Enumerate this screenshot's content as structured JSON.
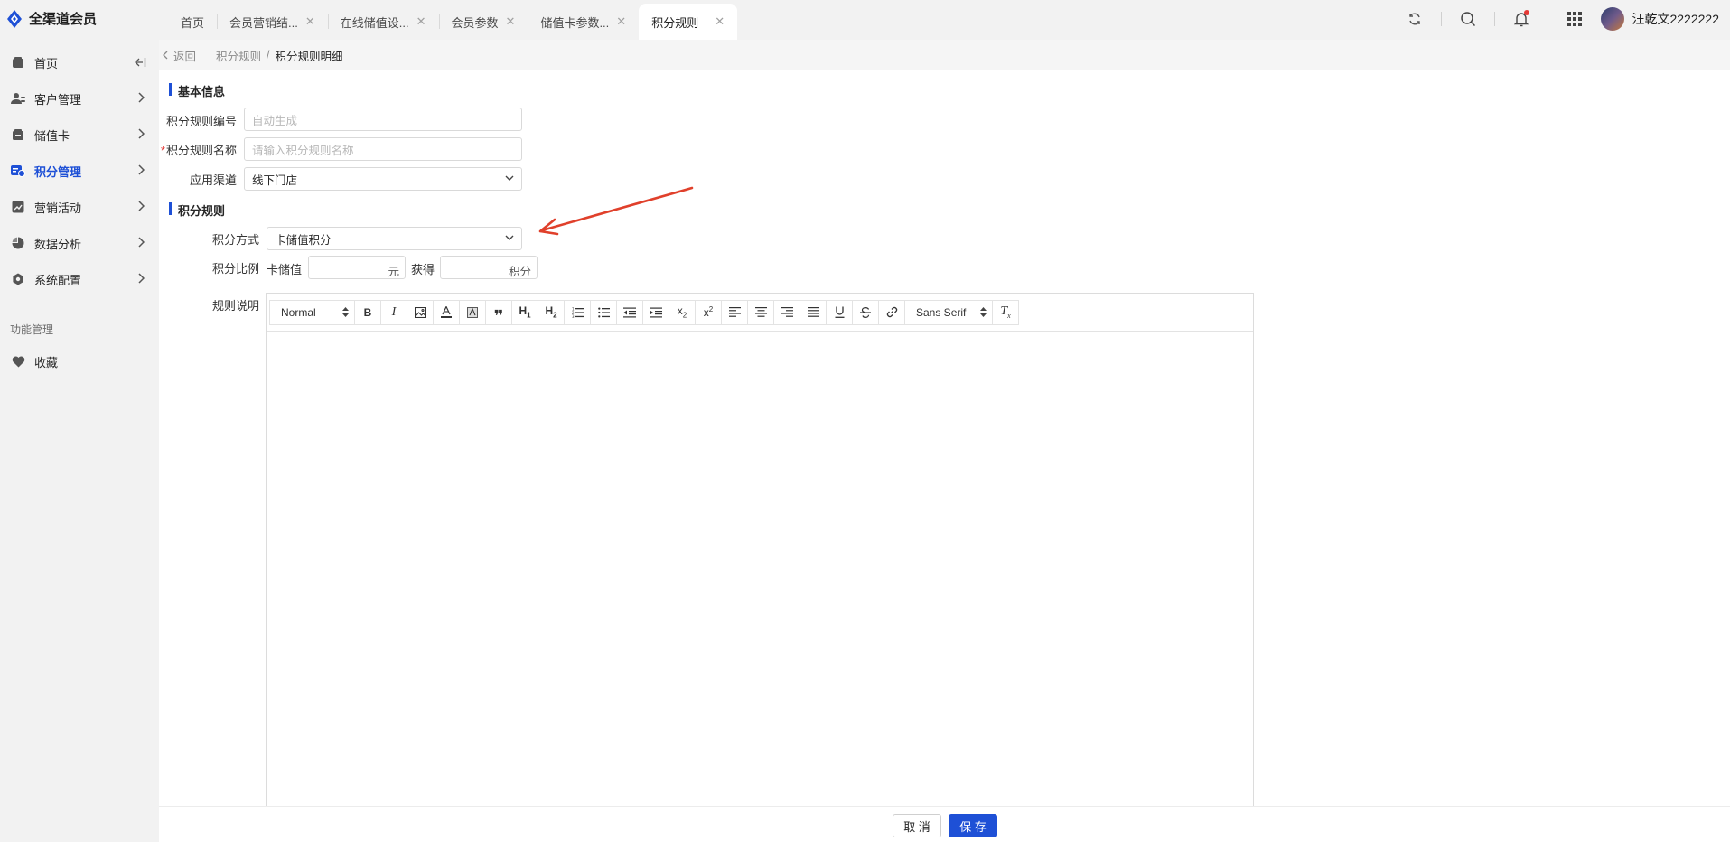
{
  "app": {
    "title": "全渠道会员"
  },
  "tabs": [
    {
      "label": "首页",
      "closable": false
    },
    {
      "label": "会员营销结...",
      "closable": true
    },
    {
      "label": "在线储值设...",
      "closable": true
    },
    {
      "label": "会员参数",
      "closable": true
    },
    {
      "label": "储值卡参数...",
      "closable": true
    },
    {
      "label": "积分规则",
      "closable": true,
      "active": true
    }
  ],
  "user": {
    "name": "汪乾文2222222"
  },
  "sidebar": {
    "items": [
      {
        "label": "首页",
        "icon": "home-icon"
      },
      {
        "label": "客户管理",
        "icon": "users-icon"
      },
      {
        "label": "储值卡",
        "icon": "card-box-icon"
      },
      {
        "label": "积分管理",
        "icon": "points-icon",
        "active": true
      },
      {
        "label": "营销活动",
        "icon": "chart-icon"
      },
      {
        "label": "数据分析",
        "icon": "pie-icon"
      },
      {
        "label": "系统配置",
        "icon": "settings-icon"
      }
    ],
    "group_label": "功能管理",
    "favorites": {
      "label": "收藏",
      "icon": "heart-icon"
    }
  },
  "breadcrumb": {
    "back": "返回",
    "parent": "积分规则",
    "current": "积分规则明细"
  },
  "basic": {
    "title": "基本信息",
    "code_label": "积分规则编号",
    "code_placeholder": "自动生成",
    "name_label": "积分规则名称",
    "name_placeholder": "请输入积分规则名称",
    "channel_label": "应用渠道",
    "channel_value": "线下门店"
  },
  "rules": {
    "title": "积分规则",
    "method_label": "积分方式",
    "method_value": "卡储值积分",
    "ratio_label": "积分比例",
    "ratio_prefix": "卡储值",
    "ratio_unit": "元",
    "ratio_mid": "获得",
    "ratio_points_unit": "积分",
    "desc_label": "规则说明"
  },
  "editor": {
    "header_select": "Normal",
    "font_select": "Sans Serif",
    "buttons": [
      "bold-icon",
      "italic-icon",
      "image-icon",
      "font-color-icon",
      "background-color-icon",
      "blockquote-icon",
      "h1-icon",
      "h2-icon",
      "ordered-list-icon",
      "bullet-list-icon",
      "outdent-icon",
      "indent-icon",
      "subscript-icon",
      "superscript-icon",
      "align-left-icon",
      "align-center-icon",
      "align-right-icon",
      "align-justify-icon",
      "underline-icon",
      "strike-icon",
      "link-icon"
    ]
  },
  "footer": {
    "cancel": "取 消",
    "save": "保 存"
  },
  "colors": {
    "accent": "#1e50d6",
    "annotation_arrow": "#e0402b"
  }
}
